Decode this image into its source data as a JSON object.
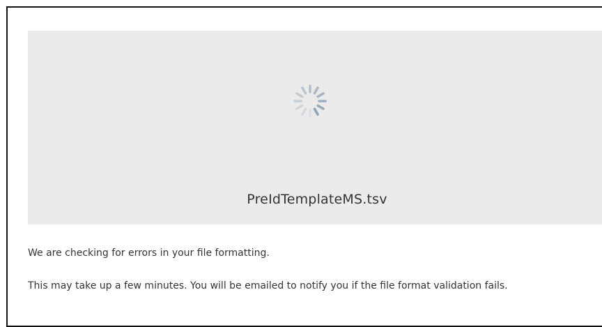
{
  "upload": {
    "file_name": "PreIdTemplateMS.tsv",
    "status_icon": "loading-spinner-icon",
    "checking_message": "We are checking for errors in your file formatting.",
    "wait_message": "This may take up a few minutes. You will be emailed to notify you if the file format validation fails."
  },
  "colors": {
    "preview_background": "#ebebeb",
    "spinner": "#8fa4b8",
    "text": "#333333",
    "frame_border": "#111111"
  }
}
